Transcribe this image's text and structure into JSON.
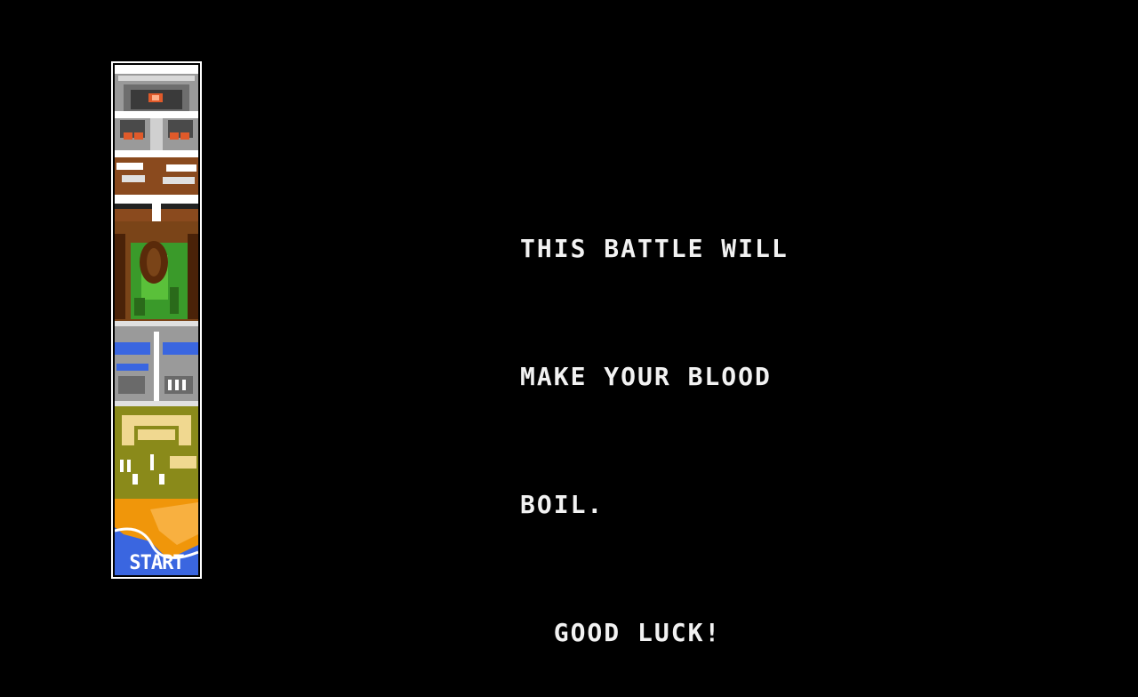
{
  "stage_map": {
    "start_label": "START",
    "zones": [
      {
        "name": "fortress",
        "color": "#8c8c8c"
      },
      {
        "name": "bridge-ruins",
        "color": "#8a4a1e"
      },
      {
        "name": "jungle-cave",
        "color": "#3a9a2a"
      },
      {
        "name": "river-base",
        "color": "#3a66e0"
      },
      {
        "name": "desert-ruins",
        "color": "#8a8a1a"
      },
      {
        "name": "beach-start",
        "color": "#f0960a"
      }
    ]
  },
  "briefing": {
    "lines": [
      "THIS BATTLE WILL",
      "MAKE YOUR BLOOD",
      "BOIL.",
      "  GOOD LUCK!"
    ]
  },
  "colors": {
    "background": "#000000",
    "text": "#f2f2f2",
    "frame": "#ffffff"
  }
}
